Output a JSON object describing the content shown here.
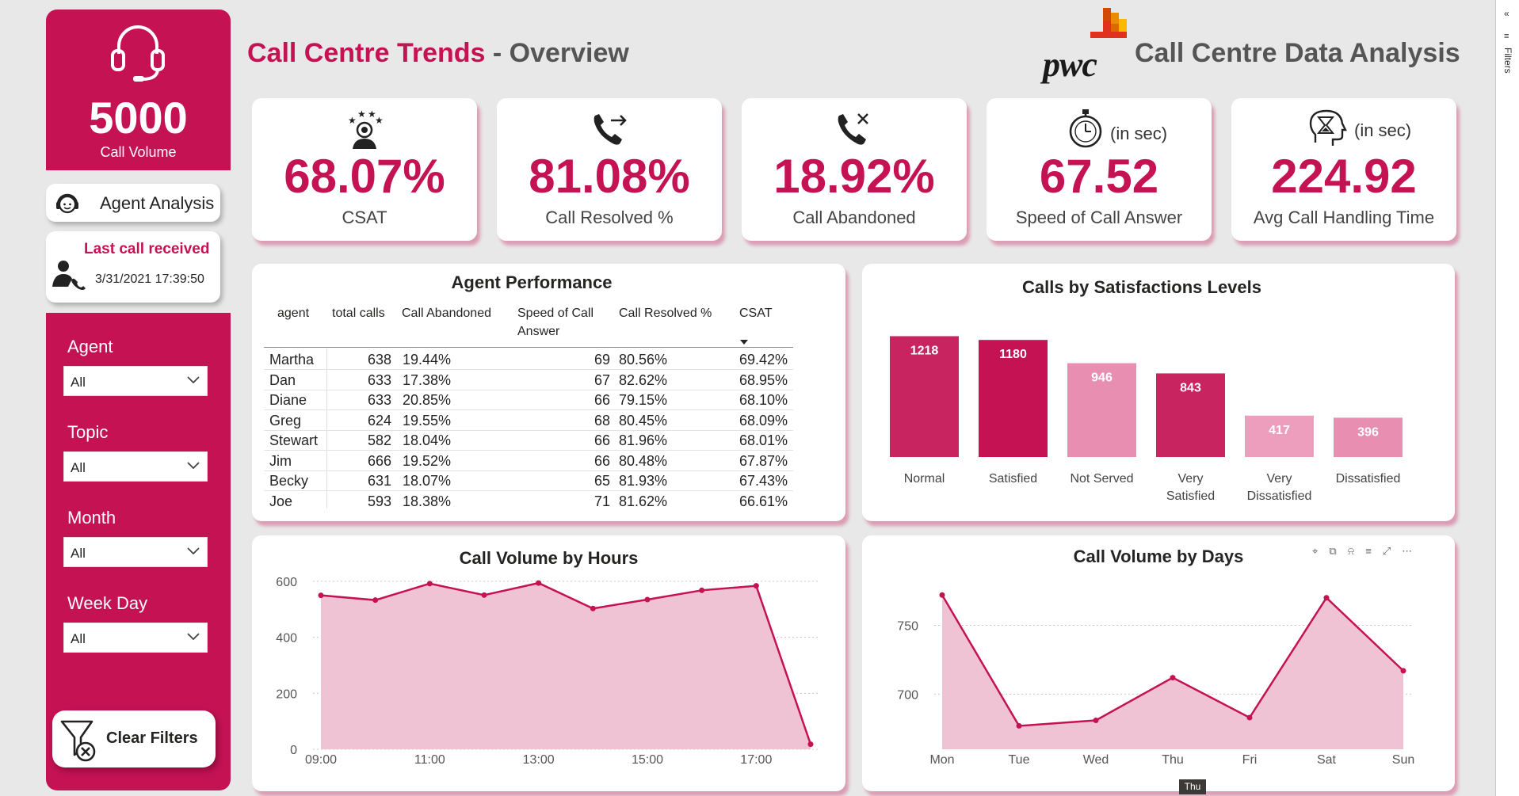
{
  "sidebar": {
    "call_volume": "5000",
    "call_volume_label": "Call Volume",
    "agent_analysis_label": "Agent Analysis",
    "last_call_title": "Last call received",
    "last_call_time": "3/31/2021 17:39:50",
    "slicers": [
      {
        "label": "Agent",
        "value": "All"
      },
      {
        "label": "Topic",
        "value": "All"
      },
      {
        "label": "Month",
        "value": "All"
      },
      {
        "label": "Week Day",
        "value": "All"
      }
    ],
    "clear_filters_label": "Clear Filters"
  },
  "header": {
    "title_main": "Call Centre Trends",
    "title_sep": " - ",
    "title_sub": "Overview",
    "brand": "pwc",
    "right_title": "Call Centre Data Analysis"
  },
  "filters_pane": {
    "label": "Filters",
    "collapse_glyph": "«"
  },
  "kpis": [
    {
      "value": "68.07%",
      "label": "CSAT",
      "unit": "",
      "icon": "csat-person-stars-icon"
    },
    {
      "value": "81.08%",
      "label": "Call Resolved %",
      "unit": "",
      "icon": "phone-forward-icon"
    },
    {
      "value": "18.92%",
      "label": "Call Abandoned",
      "unit": "",
      "icon": "phone-missed-icon"
    },
    {
      "value": "67.52",
      "label": "Speed of Call Answer",
      "unit": "(in sec)",
      "icon": "stopwatch-icon"
    },
    {
      "value": "224.92",
      "label": "Avg Call Handling Time",
      "unit": "(in sec)",
      "icon": "head-hourglass-icon"
    }
  ],
  "agent_performance": {
    "title": "Agent Performance",
    "columns": [
      "agent",
      "total calls",
      "Call Abandoned",
      "Speed of Call",
      "Answer",
      "Call Resolved %",
      "CSAT"
    ],
    "rows": [
      [
        "Martha",
        "638",
        "19.44%",
        "69",
        "80.56%",
        "69.42%"
      ],
      [
        "Dan",
        "633",
        "17.38%",
        "67",
        "82.62%",
        "68.95%"
      ],
      [
        "Diane",
        "633",
        "20.85%",
        "66",
        "79.15%",
        "68.10%"
      ],
      [
        "Greg",
        "624",
        "19.55%",
        "68",
        "80.45%",
        "68.09%"
      ],
      [
        "Stewart",
        "582",
        "18.04%",
        "66",
        "81.96%",
        "68.01%"
      ],
      [
        "Jim",
        "666",
        "19.52%",
        "66",
        "80.48%",
        "67.87%"
      ],
      [
        "Becky",
        "631",
        "18.07%",
        "65",
        "81.93%",
        "67.43%"
      ],
      [
        "Joe",
        "593",
        "18.38%",
        "71",
        "81.62%",
        "66.61%"
      ]
    ]
  },
  "chart_data": [
    {
      "type": "bar",
      "title": "Calls by Satisfactions Levels",
      "categories": [
        "Normal",
        "Satisfied",
        "Not Served",
        "Very Satisfied",
        "Very Dissatisfied",
        "Dissatisfied"
      ],
      "category_lines": [
        [
          "Normal"
        ],
        [
          "Satisfied"
        ],
        [
          "Not Served"
        ],
        [
          "Very",
          "Satisfied"
        ],
        [
          "Very",
          "Dissatisfied"
        ],
        [
          "Dissatisfied"
        ]
      ],
      "values": [
        1218,
        1180,
        946,
        843,
        417,
        396
      ],
      "colors": [
        "#c8245f",
        "#c41253",
        "#e88fb1",
        "#c8245f",
        "#ee9ebd",
        "#e88fb1"
      ]
    },
    {
      "type": "area",
      "title": "Call Volume by Hours",
      "x": [
        "09:00",
        "10:00",
        "11:00",
        "12:00",
        "13:00",
        "14:00",
        "15:00",
        "16:00",
        "17:00",
        "18:00"
      ],
      "xticks": [
        "09:00",
        "11:00",
        "13:00",
        "15:00",
        "17:00"
      ],
      "values": [
        550,
        533,
        592,
        551,
        594,
        503,
        535,
        568,
        584,
        18
      ],
      "ylim": [
        0,
        600
      ],
      "yticks": [
        "0",
        "200",
        "400",
        "600"
      ],
      "grid": true
    },
    {
      "type": "area",
      "title": "Call Volume by Days",
      "x": [
        "Mon",
        "Tue",
        "Wed",
        "Thu",
        "Fri",
        "Sat",
        "Sun"
      ],
      "values": [
        772,
        677,
        681,
        712,
        683,
        770,
        717
      ],
      "ylim": [
        660,
        770
      ],
      "yticks": [
        "700",
        "750"
      ],
      "grid": true,
      "tooltip": "Thu"
    }
  ],
  "colors": {
    "accent": "#c41253",
    "area_fill": "#f0c3d4",
    "line": "#c41253"
  }
}
